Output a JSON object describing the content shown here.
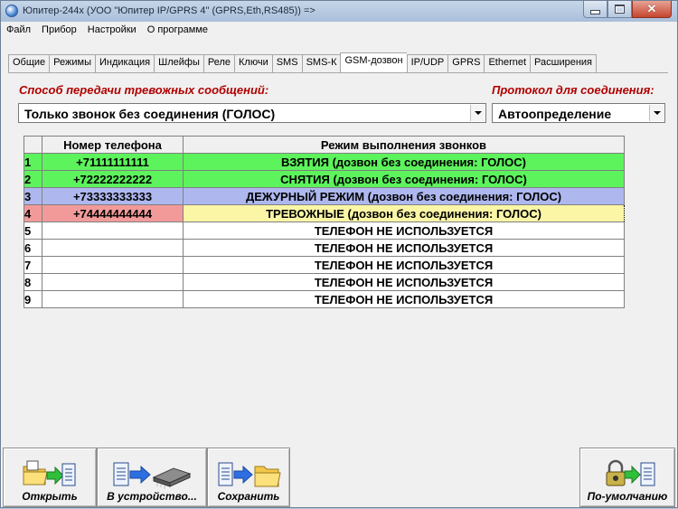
{
  "window": {
    "title": "Юпитер-244x (УОО \"Юпитер IP/GPRS 4\" (GPRS,Eth,RS485))   =>"
  },
  "menu": [
    "Файл",
    "Прибор",
    "Настройки",
    "О программе"
  ],
  "tabs": [
    "Общие",
    "Режимы",
    "Индикация",
    "Шлейфы",
    "Реле",
    "Ключи",
    "SMS",
    "SMS-К",
    "GSM-дозвон",
    "IP/UDP",
    "GPRS",
    "Ethernet",
    "Расширения"
  ],
  "active_tab": "GSM-дозвон",
  "transfer": {
    "label": "Способ передачи тревожных сообщений:",
    "value": "Только звонок без соединения (ГОЛОС)"
  },
  "protocol": {
    "label": "Протокол для соединения:",
    "value": "Автоопределение"
  },
  "table": {
    "headers": [
      "",
      "Номер телефона",
      "Режим выполнения звонков"
    ],
    "rows": [
      {
        "num": "1",
        "phone": "+71111111111",
        "mode": "ВЗЯТИЯ (дозвон без соединения: ГОЛОС)",
        "color": "#5cf35c"
      },
      {
        "num": "2",
        "phone": "+72222222222",
        "mode": "СНЯТИЯ (дозвон без соединения: ГОЛОС)",
        "color": "#5cf35c"
      },
      {
        "num": "3",
        "phone": "+73333333333",
        "mode": "ДЕЖУРНЫЙ РЕЖИМ (дозвон без соединения: ГОЛОС)",
        "color": "#aeb8ef"
      },
      {
        "num": "4",
        "phone": "+74444444444",
        "mode": "ТРЕВОЖНЫЕ (дозвон без соединения: ГОЛОС)",
        "color": "#f29a9a"
      },
      {
        "num": "5",
        "phone": "",
        "mode": "ТЕЛЕФОН НЕ ИСПОЛЬЗУЕТСЯ",
        "color": "#ffffff"
      },
      {
        "num": "6",
        "phone": "",
        "mode": "ТЕЛЕФОН НЕ ИСПОЛЬЗУЕТСЯ",
        "color": "#ffffff"
      },
      {
        "num": "7",
        "phone": "",
        "mode": "ТЕЛЕФОН НЕ ИСПОЛЬЗУЕТСЯ",
        "color": "#ffffff"
      },
      {
        "num": "8",
        "phone": "",
        "mode": "ТЕЛЕФОН НЕ ИСПОЛЬЗУЕТСЯ",
        "color": "#ffffff"
      },
      {
        "num": "9",
        "phone": "",
        "mode": "ТЕЛЕФОН НЕ ИСПОЛЬЗУЕТСЯ",
        "color": "#ffffff"
      }
    ]
  },
  "toolbar": {
    "open": {
      "label": "Открыть",
      "icon": "folder-to-document-icon"
    },
    "to_device": {
      "label": "В устройство...",
      "icon": "document-to-chip-icon"
    },
    "save": {
      "label": "Сохранить",
      "icon": "document-to-folder-icon"
    },
    "defaults": {
      "label": "По-умолчанию",
      "icon": "lock-to-document-icon"
    }
  }
}
